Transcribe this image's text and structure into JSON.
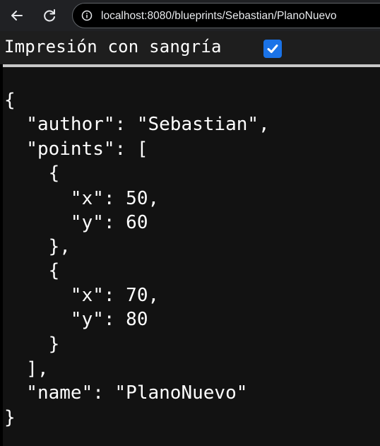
{
  "browser": {
    "url": "localhost:8080/blueprints/Sebastian/PlanoNuevo",
    "back_icon": "arrow-left-icon",
    "reload_icon": "reload-icon",
    "info_icon": "info-icon"
  },
  "viewer": {
    "pretty_print_label": "Impresión con sangría",
    "pretty_print_checked": true
  },
  "json_lines": [
    "{",
    "  \"author\": \"Sebastian\",",
    "  \"points\": [",
    "    {",
    "      \"x\": 50,",
    "      \"y\": 60",
    "    },",
    "    {",
    "      \"x\": 70,",
    "      \"y\": 80",
    "    }",
    "  ],",
    "  \"name\": \"PlanoNuevo\"",
    "}"
  ]
}
